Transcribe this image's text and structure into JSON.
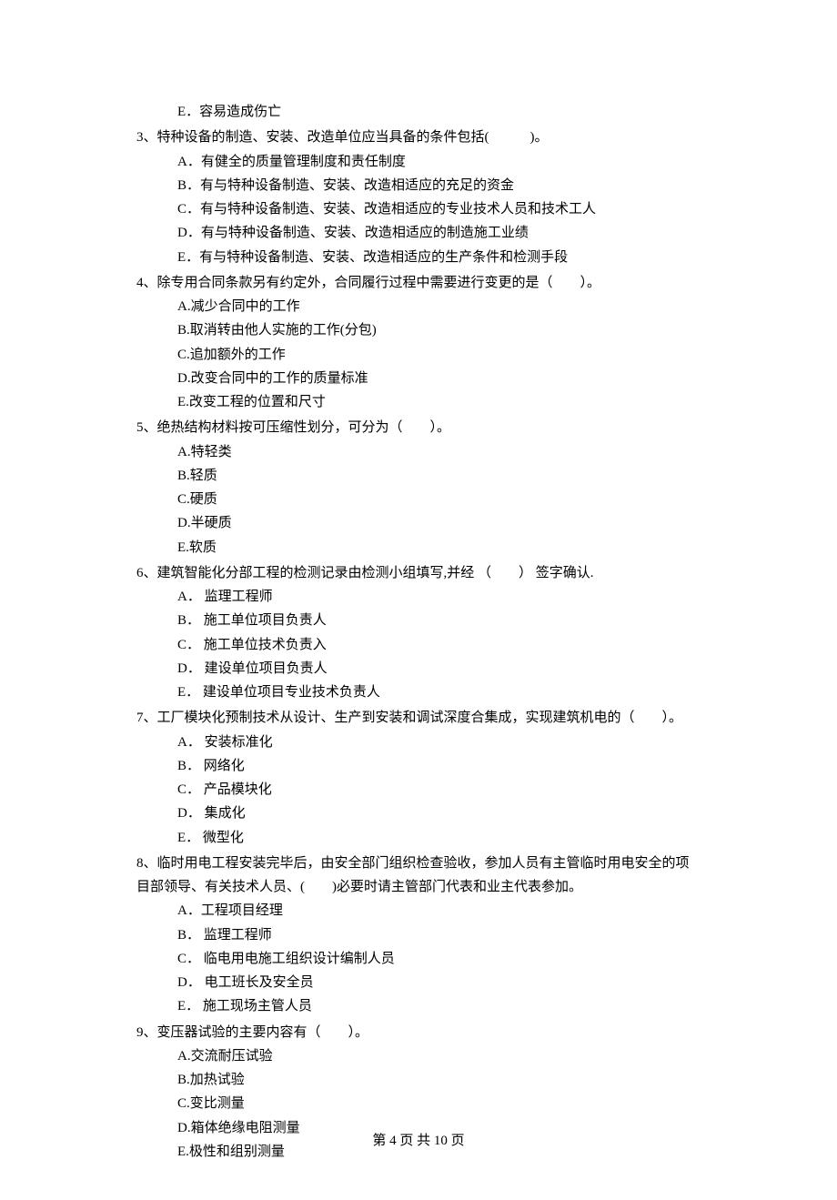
{
  "orphan": {
    "option_e": "E．容易造成伤亡"
  },
  "questions": [
    {
      "num": "3、",
      "stem": "特种设备的制造、安装、改造单位应当具备的条件包括(　　　)。",
      "options": [
        "A．有健全的质量管理制度和责任制度",
        "B．有与特种设备制造、安装、改造相适应的充足的资金",
        "C．有与特种设备制造、安装、改造相适应的专业技术人员和技术工人",
        "D．有与特种设备制造、安装、改造相适应的制造施工业绩",
        "E．有与特种设备制造、安装、改造相适应的生产条件和检测手段"
      ]
    },
    {
      "num": "4、",
      "stem": "除专用合同条款另有约定外，合同履行过程中需要进行变更的是（　　）。",
      "options": [
        "A.减少合同中的工作",
        "B.取消转由他人实施的工作(分包)",
        "C.追加额外的工作",
        "D.改变合同中的工作的质量标准",
        "E.改变工程的位置和尺寸"
      ]
    },
    {
      "num": "5、",
      "stem": "绝热结构材料按可压缩性划分，可分为（　　）。",
      "options": [
        "A.特轻类",
        "B.轻质",
        "C.硬质",
        "D.半硬质",
        "E.软质"
      ]
    },
    {
      "num": "6、",
      "stem": "建筑智能化分部工程的检测记录由检测小组填写,并经 （　　） 签字确认.",
      "options": [
        "A． 监理工程师",
        "B． 施工单位项目负责人",
        "C． 施工单位技术负责入",
        "D． 建设单位项目负责人",
        "E． 建设单位项目专业技术负责人"
      ]
    },
    {
      "num": "7、",
      "stem": "工厂模块化预制技术从设计、生产到安装和调试深度合集成，实现建筑机电的（　　）。",
      "options": [
        "A． 安装标准化",
        "B． 网络化",
        "C． 产品模块化",
        "D． 集成化",
        "E． 微型化"
      ]
    },
    {
      "num": "8、",
      "stem": "临时用电工程安装完毕后，由安全部门组织检查验收，参加人员有主管临时用电安全的项目部领导、有关技术人员、(　　)必要时请主管部门代表和业主代表参加。",
      "options": [
        "A．工程项目经理",
        "B． 监理工程师",
        "C． 临电用电施工组织设计编制人员",
        "D． 电工班长及安全员",
        "E． 施工现场主管人员"
      ]
    },
    {
      "num": "9、",
      "stem": "变压器试验的主要内容有（　　）。",
      "options": [
        "A.交流耐压试验",
        "B.加热试验",
        "C.变比测量",
        "D.箱体绝缘电阻测量",
        "E.极性和组别测量"
      ]
    }
  ],
  "footer": {
    "text": "第 4 页 共 10 页"
  }
}
